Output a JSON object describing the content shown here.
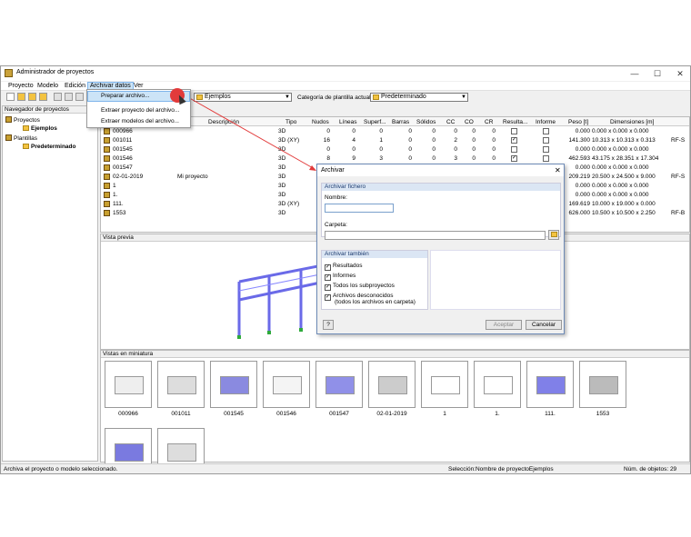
{
  "window": {
    "title": "Administrador de proyectos",
    "minimize": "—",
    "maximize": "☐",
    "close": "✕"
  },
  "menu": [
    "Proyecto",
    "Modelo",
    "Edición",
    "Archivar datos",
    "Ver"
  ],
  "dropdown": [
    "Preparar archivo...",
    "Extraer proyecto del archivo...",
    "Extraer modelos del archivo..."
  ],
  "toolbar": {
    "combo1": "Ejemplos",
    "template_label": "Categoría de plantilla actual",
    "combo2": "Predeterminado"
  },
  "nav": {
    "title": "Navegador de proyectos",
    "items": [
      {
        "label": "Proyectos",
        "level": 0
      },
      {
        "label": "Ejemplos",
        "level": 1
      },
      {
        "label": "Plantillas",
        "level": 0
      },
      {
        "label": "Predeterminado",
        "level": 1
      }
    ]
  },
  "grid": {
    "columns": [
      "Descripción",
      "Tipo",
      "Nudos",
      "Líneas",
      "Superf...",
      "Barras",
      "Sólidos",
      "CC",
      "CO",
      "CR",
      "Resulta...",
      "Informe",
      "Peso [t]",
      "Dimensiones [m]"
    ],
    "rows": [
      {
        "name": "000966",
        "desc": "",
        "tipo": "3D",
        "nudos": "0",
        "lineas": "0",
        "sup": "0",
        "barras": "0",
        "solidos": "0",
        "cc": "0",
        "co": "0",
        "cr": "0",
        "res": false,
        "inf": false,
        "peso": "0.000",
        "dim": "0.000 x 0.000 x 0.000",
        "extra": ""
      },
      {
        "name": "001011",
        "desc": "",
        "tipo": "3D (XY)",
        "nudos": "16",
        "lineas": "4",
        "sup": "1",
        "barras": "0",
        "solidos": "0",
        "cc": "2",
        "co": "0",
        "cr": "0",
        "res": true,
        "inf": false,
        "peso": "141.300",
        "dim": "10.313 x 10.313 x 0.313",
        "extra": "RF-S"
      },
      {
        "name": "001545",
        "desc": "",
        "tipo": "3D",
        "nudos": "0",
        "lineas": "0",
        "sup": "0",
        "barras": "0",
        "solidos": "0",
        "cc": "0",
        "co": "0",
        "cr": "0",
        "res": false,
        "inf": false,
        "peso": "0.000",
        "dim": "0.000 x 0.000 x 0.000",
        "extra": ""
      },
      {
        "name": "001546",
        "desc": "",
        "tipo": "3D",
        "nudos": "8",
        "lineas": "9",
        "sup": "3",
        "barras": "0",
        "solidos": "0",
        "cc": "3",
        "co": "0",
        "cr": "0",
        "res": true,
        "inf": false,
        "peso": "462.593",
        "dim": "43.175 x 28.351 x 17.304",
        "extra": ""
      },
      {
        "name": "001547",
        "desc": "",
        "tipo": "3D",
        "nudos": "",
        "lineas": "",
        "sup": "",
        "barras": "",
        "solidos": "",
        "cc": "",
        "co": "",
        "cr": "",
        "res": false,
        "inf": false,
        "peso": "0.000",
        "dim": "0.000 x 0.000 x 0.000",
        "extra": ""
      },
      {
        "name": "02-01-2019",
        "desc": "Mi proyecto",
        "tipo": "3D",
        "nudos": "",
        "lineas": "",
        "sup": "",
        "barras": "",
        "solidos": "",
        "cc": "",
        "co": "",
        "cr": "",
        "res": true,
        "inf": false,
        "peso": "209.219",
        "dim": "20.500 x 24.500 x 9.000",
        "extra": "RF-S"
      },
      {
        "name": "1",
        "desc": "",
        "tipo": "3D",
        "nudos": "",
        "lineas": "",
        "sup": "",
        "barras": "",
        "solidos": "",
        "cc": "",
        "co": "",
        "cr": "",
        "res": false,
        "inf": false,
        "peso": "0.000",
        "dim": "0.000 x 0.000 x 0.000",
        "extra": ""
      },
      {
        "name": "1.",
        "desc": "",
        "tipo": "3D",
        "nudos": "",
        "lineas": "",
        "sup": "",
        "barras": "",
        "solidos": "",
        "cc": "",
        "co": "",
        "cr": "",
        "res": false,
        "inf": false,
        "peso": "0.000",
        "dim": "0.000 x 0.000 x 0.000",
        "extra": ""
      },
      {
        "name": "111.",
        "desc": "",
        "tipo": "3D (XY)",
        "nudos": "",
        "lineas": "",
        "sup": "",
        "barras": "",
        "solidos": "",
        "cc": "",
        "co": "",
        "cr": "",
        "res": false,
        "inf": false,
        "peso": "169.619",
        "dim": "10.000 x 19.000 x 0.000",
        "extra": ""
      },
      {
        "name": "1553",
        "desc": "",
        "tipo": "3D",
        "nudos": "",
        "lineas": "",
        "sup": "",
        "barras": "",
        "solidos": "",
        "cc": "",
        "co": "",
        "cr": "",
        "res": false,
        "inf": false,
        "peso": "626.000",
        "dim": "10.500 x 10.500 x 2.250",
        "extra": "RF-B"
      }
    ]
  },
  "preview": {
    "title": "Vista previa"
  },
  "thumbs": {
    "title": "Vistas en miniatura",
    "items": [
      "000966",
      "001011",
      "001545",
      "001546",
      "001547",
      "02-01-2019",
      "1",
      "1.",
      "111.",
      "1553",
      "",
      ""
    ]
  },
  "status": {
    "left": "Archiva el proyecto o modelo seleccionado.",
    "mid": "Selección:Nombre de proyectoEjemplos",
    "right": "Núm. de objetos: 29"
  },
  "dialog": {
    "title": "Archivar",
    "group1": "Archivar fichero",
    "name_label": "Nombre:",
    "name_value": "",
    "folder_label": "Carpeta:",
    "folder_value": "",
    "group2": "Archivar también",
    "checks": [
      "Resultados",
      "Informes",
      "Todos los subproyectos",
      "Archivos desconocidos"
    ],
    "checks_sub": "(todos los archivos en carpeta)",
    "ok": "Aceptar",
    "cancel": "Cancelar"
  }
}
